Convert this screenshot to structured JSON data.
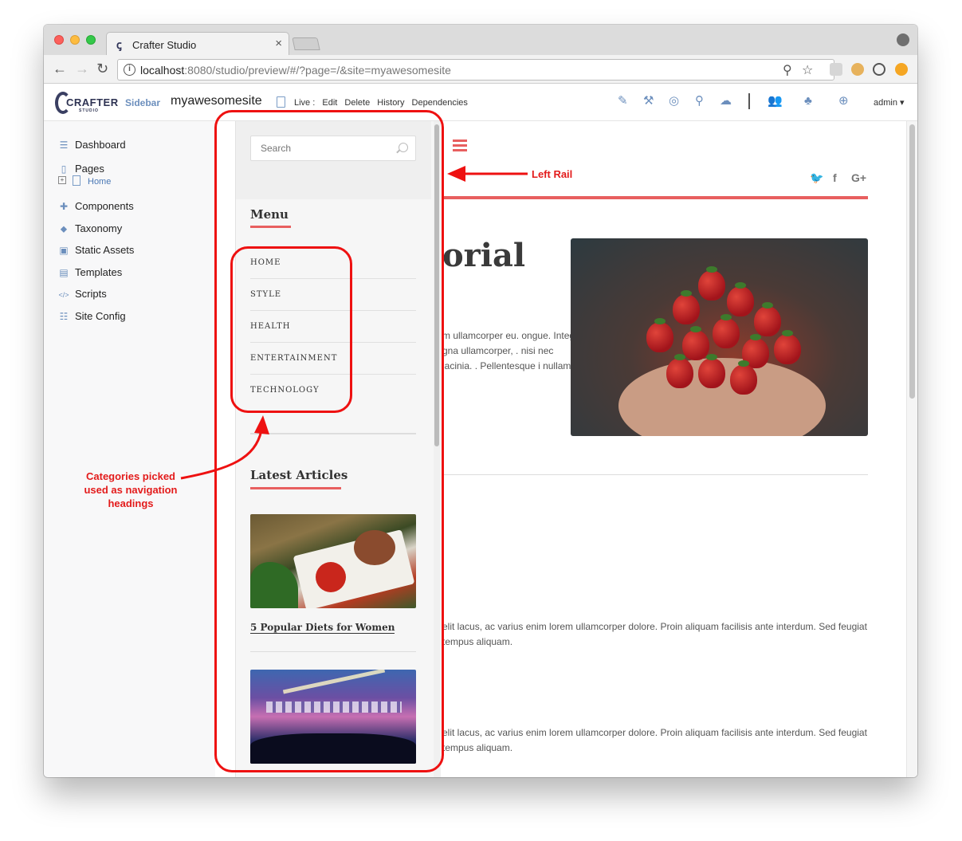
{
  "browser": {
    "tab_title": "Crafter Studio",
    "tab_close": "×",
    "url_host": "localhost",
    "url_rest": ":8080/studio/preview/#/?page=/&site=myawesomesite",
    "back_icon": "←",
    "forward_icon": "→",
    "reload_icon": "↻",
    "info_icon": "i",
    "zoom_icon": "⚲",
    "star_icon": "☆"
  },
  "studio": {
    "logo_text": "CRAFTER",
    "logo_sub": "STUDIO",
    "sidebar_label": "Sidebar",
    "site_name": "myawesomesite",
    "status_live": "Live :",
    "actions": [
      "Edit",
      "Delete",
      "History",
      "Dependencies"
    ],
    "admin_label": "admin ▾",
    "accent_color": "#6c8fbd"
  },
  "nav": {
    "items": [
      {
        "label": "Dashboard",
        "icon": "dashboard-icon",
        "glyph": "☰"
      },
      {
        "label": "Pages",
        "icon": "pages-icon",
        "glyph": "▯"
      },
      {
        "label": "Components",
        "icon": "components-icon",
        "glyph": "✚"
      },
      {
        "label": "Taxonomy",
        "icon": "tag-icon",
        "glyph": "⬥"
      },
      {
        "label": "Static Assets",
        "icon": "image-icon",
        "glyph": "▣"
      },
      {
        "label": "Templates",
        "icon": "template-icon",
        "glyph": "▤"
      },
      {
        "label": "Scripts",
        "icon": "code-icon",
        "glyph": "</>"
      },
      {
        "label": "Site Config",
        "icon": "sliders-icon",
        "glyph": "☷"
      }
    ],
    "pages_child": "Home",
    "expand_glyph": "+"
  },
  "preview": {
    "hero_title_fragment": "orial",
    "hero_para": "m ullamcorper eu. ongue. Integer gna ullamcorper, . nisi nec lacinia. . Pellentesque i nullam.",
    "body_para_1": "elit lacus, ac varius enim lorem ullamcorper dolore. Proin aliquam facilisis ante interdum. Sed feugiat tempus aliquam.",
    "body_para_2": "elit lacus, ac varius enim lorem ullamcorper dolore. Proin aliquam facilisis ante interdum. Sed feugiat tempus aliquam.",
    "social": [
      "twitter-icon",
      "facebook-icon",
      "google-plus-icon"
    ],
    "social_glyphs": [
      "🐦",
      "f",
      "G+"
    ],
    "accent_color": "#e85f5f"
  },
  "rail": {
    "search_placeholder": "Search",
    "menu_heading": "Menu",
    "menu_items": [
      "HOME",
      "STYLE",
      "HEALTH",
      "ENTERTAINMENT",
      "TECHNOLOGY"
    ],
    "latest_heading": "Latest Articles",
    "articles": [
      {
        "title": "5 Popular Diets for Women"
      },
      {
        "title": ""
      }
    ]
  },
  "annotations": {
    "left_rail": "Left Rail",
    "categories": "Categories picked used as navigation headings",
    "color": "#ee1111"
  }
}
